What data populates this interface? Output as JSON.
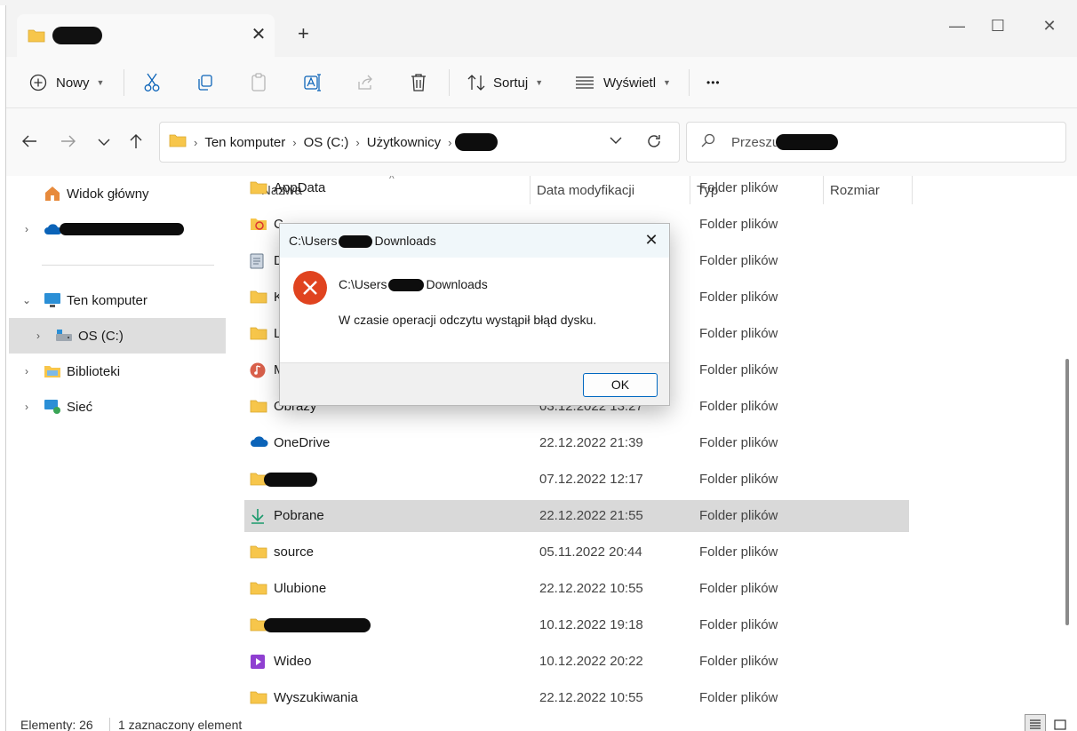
{
  "tab": {
    "close_glyph": "✕",
    "new_glyph": "+"
  },
  "window_controls": {
    "minimize": "—",
    "maximize": "☐",
    "close": "✕"
  },
  "toolbar": {
    "new_label": "Nowy",
    "sort_label": "Sortuj",
    "view_label": "Wyświetl",
    "more_glyph": "•••"
  },
  "address": {
    "segments": [
      "Ten komputer",
      "OS (C:)",
      "Użytkownicy"
    ]
  },
  "search": {
    "placeholder": "Przeszuka"
  },
  "sidebar": {
    "home": "Widok główny",
    "this_pc": "Ten komputer",
    "os_c": "OS (C:)",
    "libraries": "Biblioteki",
    "network": "Sieć"
  },
  "columns": {
    "name": "Nazwa",
    "date": "Data modyfikacji",
    "type": "Typ",
    "size": "Rozmiar"
  },
  "files": [
    {
      "name": "AppData",
      "date": "",
      "type": "Folder plików",
      "icon": "folder"
    },
    {
      "name": "C",
      "date": "",
      "type": "Folder plików",
      "icon": "special-folder-icon"
    },
    {
      "name": "D",
      "date": "",
      "type": "Folder plików",
      "icon": "document-icon"
    },
    {
      "name": "K",
      "date": "",
      "type": "Folder plików",
      "icon": "folder"
    },
    {
      "name": "L",
      "date": "",
      "type": "Folder plików",
      "icon": "folder"
    },
    {
      "name": "M",
      "date": "",
      "type": "Folder plików",
      "icon": "music-icon"
    },
    {
      "name": "Obrazy",
      "date": "03.12.2022 13:27",
      "type": "Folder plików",
      "icon": "folder"
    },
    {
      "name": "OneDrive",
      "date": "22.12.2022 21:39",
      "type": "Folder plików",
      "icon": "cloud-icon"
    },
    {
      "name": "",
      "date": "07.12.2022 12:17",
      "type": "Folder plików",
      "icon": "folder"
    },
    {
      "name": "Pobrane",
      "date": "22.12.2022 21:55",
      "type": "Folder plików",
      "icon": "download-icon"
    },
    {
      "name": "source",
      "date": "05.11.2022 20:44",
      "type": "Folder plików",
      "icon": "folder"
    },
    {
      "name": "Ulubione",
      "date": "22.12.2022 10:55",
      "type": "Folder plików",
      "icon": "folder"
    },
    {
      "name": "",
      "date": "10.12.2022 19:18",
      "type": "Folder plików",
      "icon": "folder"
    },
    {
      "name": "Wideo",
      "date": "10.12.2022 20:22",
      "type": "Folder plików",
      "icon": "video-icon"
    },
    {
      "name": "Wyszukiwania",
      "date": "22.12.2022 10:55",
      "type": "Folder plików",
      "icon": "folder"
    }
  ],
  "status": {
    "count": "Elementy: 26",
    "selected": "1 zaznaczony element"
  },
  "dialog": {
    "title_prefix": "C:\\Users",
    "title_suffix": "Downloads",
    "path_prefix": "C:\\Users",
    "path_suffix": "Downloads",
    "message": "W czasie operacji odczytu wystąpił błąd dysku.",
    "ok_label": "OK",
    "close_glyph": "✕"
  },
  "colors": {
    "accent": "#0067c0",
    "folder": "#f7c64b",
    "error": "#e0431f",
    "selected_row": "#d9d9d9"
  }
}
